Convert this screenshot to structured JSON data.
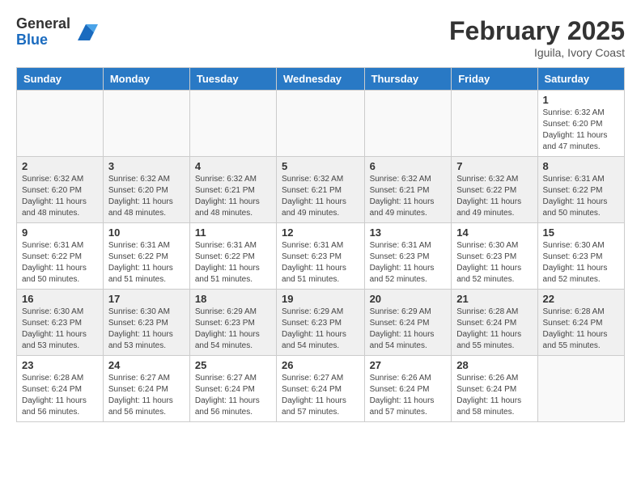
{
  "logo": {
    "general": "General",
    "blue": "Blue"
  },
  "title": "February 2025",
  "location": "Iguila, Ivory Coast",
  "days_of_week": [
    "Sunday",
    "Monday",
    "Tuesday",
    "Wednesday",
    "Thursday",
    "Friday",
    "Saturday"
  ],
  "weeks": [
    {
      "shaded": false,
      "days": [
        {
          "num": "",
          "info": ""
        },
        {
          "num": "",
          "info": ""
        },
        {
          "num": "",
          "info": ""
        },
        {
          "num": "",
          "info": ""
        },
        {
          "num": "",
          "info": ""
        },
        {
          "num": "",
          "info": ""
        },
        {
          "num": "1",
          "info": "Sunrise: 6:32 AM\nSunset: 6:20 PM\nDaylight: 11 hours\nand 47 minutes."
        }
      ]
    },
    {
      "shaded": true,
      "days": [
        {
          "num": "2",
          "info": "Sunrise: 6:32 AM\nSunset: 6:20 PM\nDaylight: 11 hours\nand 48 minutes."
        },
        {
          "num": "3",
          "info": "Sunrise: 6:32 AM\nSunset: 6:20 PM\nDaylight: 11 hours\nand 48 minutes."
        },
        {
          "num": "4",
          "info": "Sunrise: 6:32 AM\nSunset: 6:21 PM\nDaylight: 11 hours\nand 48 minutes."
        },
        {
          "num": "5",
          "info": "Sunrise: 6:32 AM\nSunset: 6:21 PM\nDaylight: 11 hours\nand 49 minutes."
        },
        {
          "num": "6",
          "info": "Sunrise: 6:32 AM\nSunset: 6:21 PM\nDaylight: 11 hours\nand 49 minutes."
        },
        {
          "num": "7",
          "info": "Sunrise: 6:32 AM\nSunset: 6:22 PM\nDaylight: 11 hours\nand 49 minutes."
        },
        {
          "num": "8",
          "info": "Sunrise: 6:31 AM\nSunset: 6:22 PM\nDaylight: 11 hours\nand 50 minutes."
        }
      ]
    },
    {
      "shaded": false,
      "days": [
        {
          "num": "9",
          "info": "Sunrise: 6:31 AM\nSunset: 6:22 PM\nDaylight: 11 hours\nand 50 minutes."
        },
        {
          "num": "10",
          "info": "Sunrise: 6:31 AM\nSunset: 6:22 PM\nDaylight: 11 hours\nand 51 minutes."
        },
        {
          "num": "11",
          "info": "Sunrise: 6:31 AM\nSunset: 6:22 PM\nDaylight: 11 hours\nand 51 minutes."
        },
        {
          "num": "12",
          "info": "Sunrise: 6:31 AM\nSunset: 6:23 PM\nDaylight: 11 hours\nand 51 minutes."
        },
        {
          "num": "13",
          "info": "Sunrise: 6:31 AM\nSunset: 6:23 PM\nDaylight: 11 hours\nand 52 minutes."
        },
        {
          "num": "14",
          "info": "Sunrise: 6:30 AM\nSunset: 6:23 PM\nDaylight: 11 hours\nand 52 minutes."
        },
        {
          "num": "15",
          "info": "Sunrise: 6:30 AM\nSunset: 6:23 PM\nDaylight: 11 hours\nand 52 minutes."
        }
      ]
    },
    {
      "shaded": true,
      "days": [
        {
          "num": "16",
          "info": "Sunrise: 6:30 AM\nSunset: 6:23 PM\nDaylight: 11 hours\nand 53 minutes."
        },
        {
          "num": "17",
          "info": "Sunrise: 6:30 AM\nSunset: 6:23 PM\nDaylight: 11 hours\nand 53 minutes."
        },
        {
          "num": "18",
          "info": "Sunrise: 6:29 AM\nSunset: 6:23 PM\nDaylight: 11 hours\nand 54 minutes."
        },
        {
          "num": "19",
          "info": "Sunrise: 6:29 AM\nSunset: 6:23 PM\nDaylight: 11 hours\nand 54 minutes."
        },
        {
          "num": "20",
          "info": "Sunrise: 6:29 AM\nSunset: 6:24 PM\nDaylight: 11 hours\nand 54 minutes."
        },
        {
          "num": "21",
          "info": "Sunrise: 6:28 AM\nSunset: 6:24 PM\nDaylight: 11 hours\nand 55 minutes."
        },
        {
          "num": "22",
          "info": "Sunrise: 6:28 AM\nSunset: 6:24 PM\nDaylight: 11 hours\nand 55 minutes."
        }
      ]
    },
    {
      "shaded": false,
      "days": [
        {
          "num": "23",
          "info": "Sunrise: 6:28 AM\nSunset: 6:24 PM\nDaylight: 11 hours\nand 56 minutes."
        },
        {
          "num": "24",
          "info": "Sunrise: 6:27 AM\nSunset: 6:24 PM\nDaylight: 11 hours\nand 56 minutes."
        },
        {
          "num": "25",
          "info": "Sunrise: 6:27 AM\nSunset: 6:24 PM\nDaylight: 11 hours\nand 56 minutes."
        },
        {
          "num": "26",
          "info": "Sunrise: 6:27 AM\nSunset: 6:24 PM\nDaylight: 11 hours\nand 57 minutes."
        },
        {
          "num": "27",
          "info": "Sunrise: 6:26 AM\nSunset: 6:24 PM\nDaylight: 11 hours\nand 57 minutes."
        },
        {
          "num": "28",
          "info": "Sunrise: 6:26 AM\nSunset: 6:24 PM\nDaylight: 11 hours\nand 58 minutes."
        },
        {
          "num": "",
          "info": ""
        }
      ]
    }
  ]
}
